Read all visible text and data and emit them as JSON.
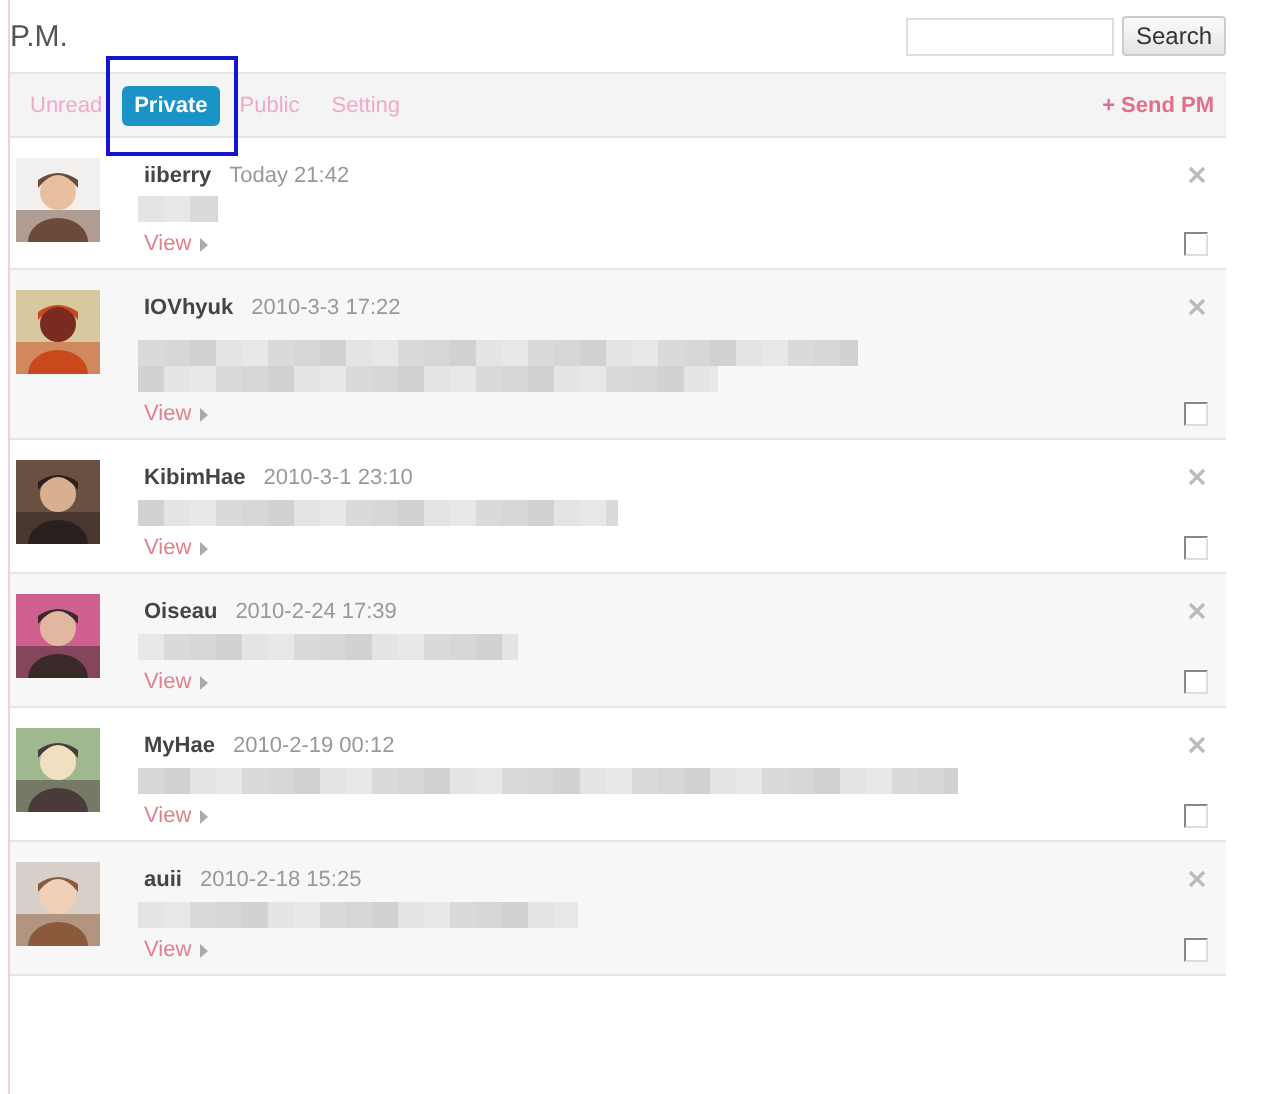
{
  "header": {
    "title": "P.M.",
    "search": {
      "button": "Search"
    }
  },
  "tabs": [
    {
      "label": "Unread",
      "selected": false,
      "highlighted": false
    },
    {
      "label": "Private",
      "selected": true,
      "highlighted": true
    },
    {
      "label": "Public",
      "selected": false,
      "highlighted": false
    },
    {
      "label": "Setting",
      "selected": false,
      "highlighted": false
    }
  ],
  "send_link": "+ Send PM",
  "messages": [
    {
      "sender": "iiberry",
      "time": "Today 21:42",
      "message": {
        "kind": "short"
      },
      "link": "View",
      "checked": false
    },
    {
      "sender": "IOVhyuk",
      "time": "2010-3-3 17:22",
      "message": {
        "kind": "two-lines"
      },
      "link": "View",
      "checked": false
    },
    {
      "sender": "KibimHae",
      "time": "2010-3-1 23:10",
      "message": {
        "kind": "line"
      },
      "link": "View",
      "checked": false
    },
    {
      "sender": "Oiseau",
      "time": "2010-2-24 17:39",
      "message": {
        "kind": "line"
      },
      "link": "View",
      "checked": false
    },
    {
      "sender": "MyHae",
      "time": "2010-2-19 00:12",
      "message": {
        "kind": "line"
      },
      "link": "View",
      "checked": false
    },
    {
      "sender": "auii",
      "time": "2010-2-18 15:25",
      "message": {
        "kind": "line"
      },
      "link": "View",
      "checked": false
    }
  ]
}
